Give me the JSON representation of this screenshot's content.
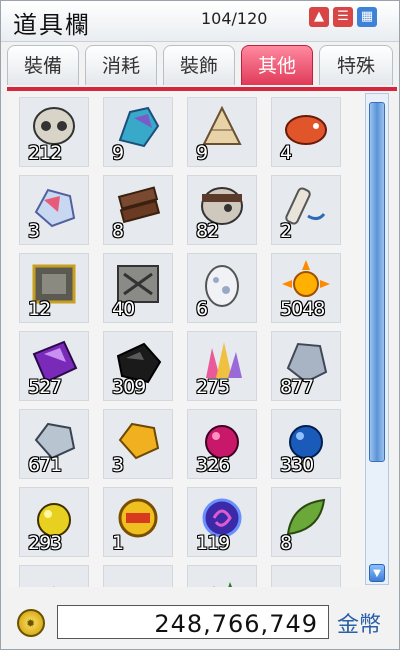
{
  "window": {
    "title": "道具欄",
    "count": "104/120",
    "buttons": [
      "up",
      "menu",
      "grid"
    ]
  },
  "tabs": [
    {
      "label": "裝備",
      "active": false
    },
    {
      "label": "消耗",
      "active": false
    },
    {
      "label": "裝飾",
      "active": false
    },
    {
      "label": "其他",
      "active": true
    },
    {
      "label": "特殊",
      "active": false
    }
  ],
  "items": [
    {
      "icon": "skull-icon",
      "qty": "212"
    },
    {
      "icon": "blue-crystal-icon",
      "qty": "9"
    },
    {
      "icon": "shell-horn-icon",
      "qty": "9"
    },
    {
      "icon": "red-fish-icon",
      "qty": "4"
    },
    {
      "icon": "pink-ore-icon",
      "qty": "3"
    },
    {
      "icon": "wood-planks-icon",
      "qty": "8"
    },
    {
      "icon": "helmet-skull-icon",
      "qty": "82"
    },
    {
      "icon": "scroll-icon",
      "qty": "2"
    },
    {
      "icon": "dark-stone-plate-icon",
      "qty": "12"
    },
    {
      "icon": "grey-stone-plate-icon",
      "qty": "40"
    },
    {
      "icon": "egg-icon",
      "qty": "6"
    },
    {
      "icon": "sun-icon",
      "qty": "5048"
    },
    {
      "icon": "purple-ore-icon",
      "qty": "527"
    },
    {
      "icon": "black-ore-icon",
      "qty": "309"
    },
    {
      "icon": "gem-cluster-icon",
      "qty": "275"
    },
    {
      "icon": "grey-rock-icon",
      "qty": "877"
    },
    {
      "icon": "silver-nugget-icon",
      "qty": "671"
    },
    {
      "icon": "gold-nugget-icon",
      "qty": "3"
    },
    {
      "icon": "pink-orb-icon",
      "qty": "326"
    },
    {
      "icon": "blue-orb-icon",
      "qty": "330"
    },
    {
      "icon": "yellow-orb-icon",
      "qty": "293"
    },
    {
      "icon": "gold-badge-icon",
      "qty": "1"
    },
    {
      "icon": "swirl-orb-icon",
      "qty": "119"
    },
    {
      "icon": "leaf-icon",
      "qty": "8"
    },
    {
      "icon": "orange-item-icon",
      "qty": ""
    },
    {
      "icon": "white-item-icon",
      "qty": ""
    },
    {
      "icon": "green-leaves-icon",
      "qty": ""
    },
    {
      "icon": "grey-item-icon",
      "qty": ""
    }
  ],
  "footer": {
    "money": "248,766,749",
    "money_label": "金幣"
  },
  "colors": {
    "accent": "#d3273e",
    "scroll": "#5a93d6"
  }
}
